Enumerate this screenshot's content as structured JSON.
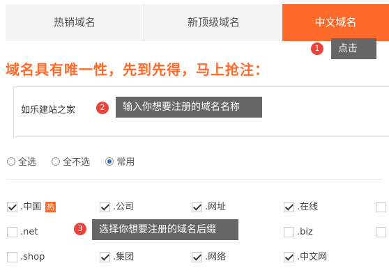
{
  "tabs": [
    {
      "label": "热销域名",
      "active": false
    },
    {
      "label": "新顶级域名",
      "active": false
    },
    {
      "label": "中文域名",
      "active": true
    }
  ],
  "tooltips": [
    {
      "num": "1",
      "text": "点击"
    },
    {
      "num": "2",
      "text": "输入你想要注册的域名名称"
    },
    {
      "num": "3",
      "text": "选择你想要注册的域名后缀"
    }
  ],
  "headline": "域名具有唯一性，先到先得，马上抢注：",
  "domain_input": {
    "value": "如乐建站之家"
  },
  "selection": {
    "options": [
      {
        "label": "全选",
        "selected": false
      },
      {
        "label": "全不选",
        "selected": false
      },
      {
        "label": "常用",
        "selected": true
      }
    ]
  },
  "suffixes": [
    {
      "label": ".中国",
      "checked": true,
      "hot": "热"
    },
    {
      "label": ".公司",
      "checked": true
    },
    {
      "label": ".网址",
      "checked": true
    },
    {
      "label": ".在线",
      "checked": true
    },
    {
      "label": "",
      "checked": false
    },
    {
      "label": ".net",
      "checked": false
    },
    {
      "label": "",
      "checked": false
    },
    {
      "label": "",
      "checked": false
    },
    {
      "label": ".biz",
      "checked": false
    },
    {
      "label": "",
      "checked": false
    },
    {
      "label": ".shop",
      "checked": false
    },
    {
      "label": ".集团",
      "checked": true
    },
    {
      "label": ".网络",
      "checked": true
    },
    {
      "label": ".中文网",
      "checked": true
    }
  ],
  "colors": {
    "accent": "#ff6a2b",
    "tooltip_bg": "#666666",
    "badge": "#e8453c",
    "radio_on": "#2a6fb8"
  }
}
